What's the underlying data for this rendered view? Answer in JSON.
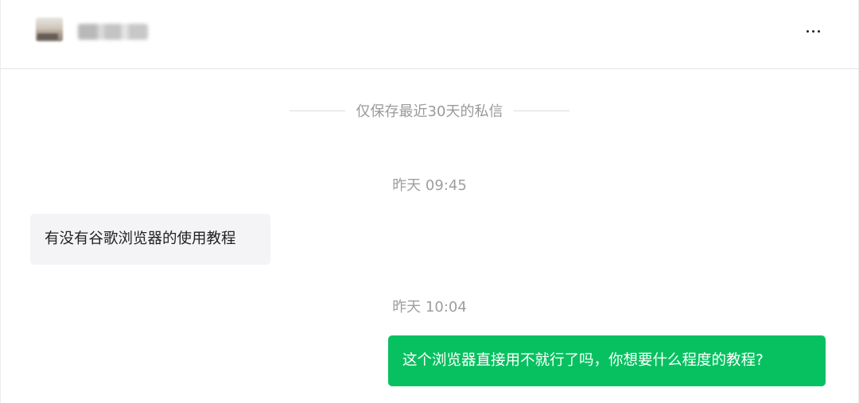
{
  "header": {
    "username": "·····",
    "more_label": "···"
  },
  "notice": {
    "text": "仅保存最近30天的私信"
  },
  "conversation": [
    {
      "timestamp": "昨天 09:45",
      "message": "有没有谷歌浏览器的使用教程",
      "direction": "incoming"
    },
    {
      "timestamp": "昨天 10:04",
      "message": "这个浏览器直接用不就行了吗，你想要什么程度的教程?",
      "direction": "outgoing"
    }
  ],
  "colors": {
    "outgoing_bubble": "#07c160",
    "incoming_bubble": "#f4f4f6",
    "muted_text": "#9a9a9a"
  },
  "icons": {
    "more": "more-horizontal-icon",
    "avatar": "avatar"
  }
}
